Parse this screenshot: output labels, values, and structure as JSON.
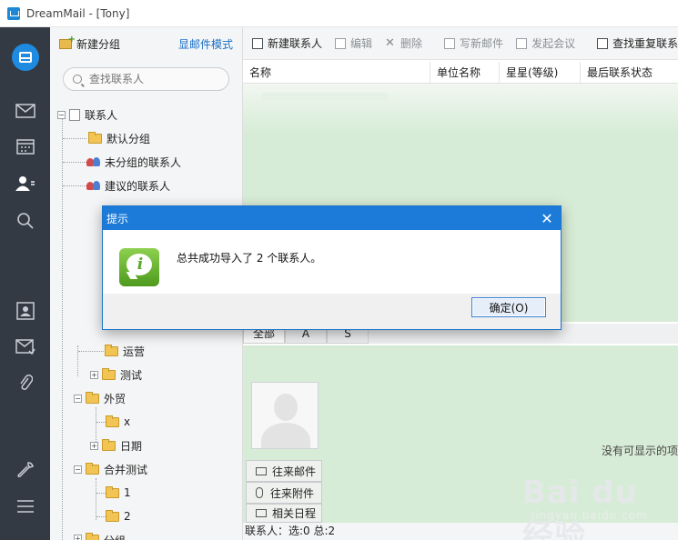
{
  "window": {
    "title": "DreamMail - [Tony]"
  },
  "tree_toolbar": {
    "new_group_label": "新建分组",
    "mail_mode_label": "显邮件模式"
  },
  "search": {
    "placeholder": "查找联系人"
  },
  "tree": {
    "root_label": "联系人",
    "items": [
      {
        "label": "默认分组"
      },
      {
        "label": "未分组的联系人"
      },
      {
        "label": "建议的联系人"
      },
      {
        "label": "运营"
      },
      {
        "label": "测试"
      },
      {
        "label": "外贸"
      },
      {
        "label": "x"
      },
      {
        "label": "日期"
      },
      {
        "label": "合并测试"
      },
      {
        "label": "1"
      },
      {
        "label": "2"
      },
      {
        "label": "分组"
      }
    ]
  },
  "main_toolbar": {
    "new_contact": "新建联系人",
    "edit": "编辑",
    "delete": "删除",
    "write_mail": "写新邮件",
    "start_meeting": "发起会议",
    "find_duplicates": "查找重复联系"
  },
  "grid": {
    "columns": [
      "名称",
      "单位名称",
      "星星(等级)",
      "最后联系状态"
    ]
  },
  "detail": {
    "tabs": [
      "全部",
      "A",
      "S"
    ],
    "buttons": [
      "往来邮件",
      "往来附件",
      "相关日程"
    ],
    "empty_message": "没有可显示的项"
  },
  "status": {
    "text": "联系人：选:0 总:2"
  },
  "dialog": {
    "title": "提示",
    "message": "总共成功导入了 2 个联系人。",
    "ok_label": "确定(O)"
  },
  "watermark": {
    "brand": "Bai du 经验",
    "url": "jingyan.baidu.com"
  },
  "colors": {
    "accent": "#1c7bd8",
    "rail": "#333a43",
    "list_bg": "#d7ecd6",
    "folder": "#f2c453"
  }
}
